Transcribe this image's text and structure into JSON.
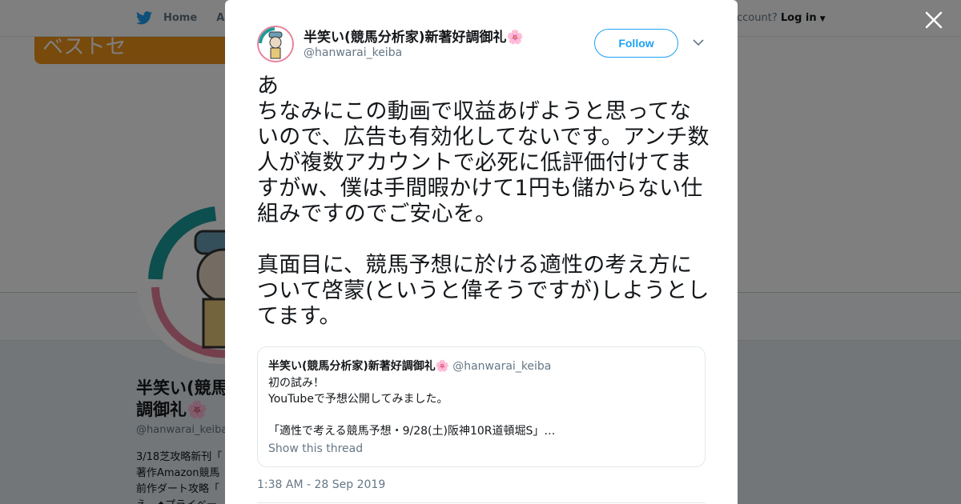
{
  "background": {
    "nav": {
      "home": "Home",
      "about": "Abo"
    },
    "account_prompt": "ccount?",
    "login": "Log in",
    "banner_text": "ベストセ",
    "profile_name": "半笑い(競馬\n調御礼🌸",
    "profile_handle": "@hanwarai_keiba",
    "bio": "3/18芝攻略新刊「\n著作Amazon競馬\n前作ダート攻略「\nえ。◆プライベー"
  },
  "tweet": {
    "display_name": "半笑い(競馬分析家)新著好調御礼🌸",
    "handle": "@hanwarai_keiba",
    "follow_label": "Follow",
    "text": "あ\nちなみにこの動画で収益あげようと思ってないので、広告も有効化してないです。アンチ数人が複数アカウントで必死に低評価付けてますがw、僕は手間暇かけて1円も儲からない仕組みですのでご安心を。\n\n真面目に、競馬予想に於ける適性の考え方について啓蒙(というと偉そうですが)しようとしてます。",
    "timestamp": "1:38 AM - 28 Sep 2019"
  },
  "quote": {
    "display_name": "半笑い(競馬分析家)新著好調御礼🌸",
    "handle": "@hanwarai_keiba",
    "text": "初の試み！\nYouTubeで予想公開してみました。\n\n「適性で考える競馬予想・9/28(土)阪神10R道頓堀S」…",
    "show_thread": "Show this thread"
  },
  "icons": [
    "twitter-bird-icon",
    "close-icon",
    "chevron-down-icon",
    "caret-down-icon"
  ],
  "colors": {
    "accent": "#1da1f2",
    "text": "#14171a",
    "muted": "#657786",
    "border": "#e1e8ed"
  }
}
